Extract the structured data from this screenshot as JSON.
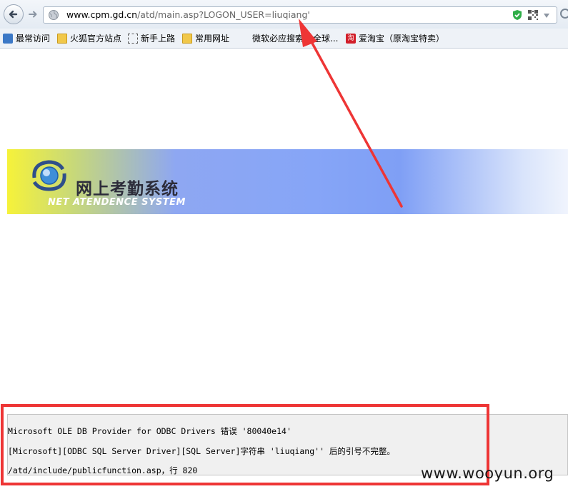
{
  "navbar": {
    "back_icon": "back-arrow-icon",
    "forward_icon": "forward-arrow-icon",
    "url_host": "www.cpm.gd.cn",
    "url_path": "/atd/main.asp?LOGON_USER=liuqiang'",
    "security_icon": "green-shield-icon",
    "qr_icon": "qr-code-icon",
    "dropdown_icon": "chevron-down-icon"
  },
  "bookmarks": [
    {
      "label": "最常访问",
      "icon": "blue-page-icon"
    },
    {
      "label": "火狐官方站点",
      "icon": "folder-icon"
    },
    {
      "label": "新手上路",
      "icon": "dashed-box-icon"
    },
    {
      "label": "常用网址",
      "icon": "folder-icon"
    },
    {
      "label": "微软必应搜索",
      "icon": "none"
    },
    {
      "label": "全球...",
      "icon": "none"
    },
    {
      "label": "爱淘宝（原淘宝特卖）",
      "icon": "taobao-icon"
    }
  ],
  "banner": {
    "title": "网上考勤系统",
    "subtitle": "NET ATENDENCE SYSTEM"
  },
  "error": {
    "line1": "Microsoft OLE DB Provider for ODBC Drivers 错误 '80040e14'",
    "line2": "[Microsoft][ODBC SQL Server Driver][SQL Server]字符串 'liuqiang'' 后的引号不完整。",
    "line3": "/atd/include/publicfunction.asp，行 820"
  },
  "annotation": {
    "color": "#ee3535"
  },
  "watermark": "www.wooyun.org"
}
